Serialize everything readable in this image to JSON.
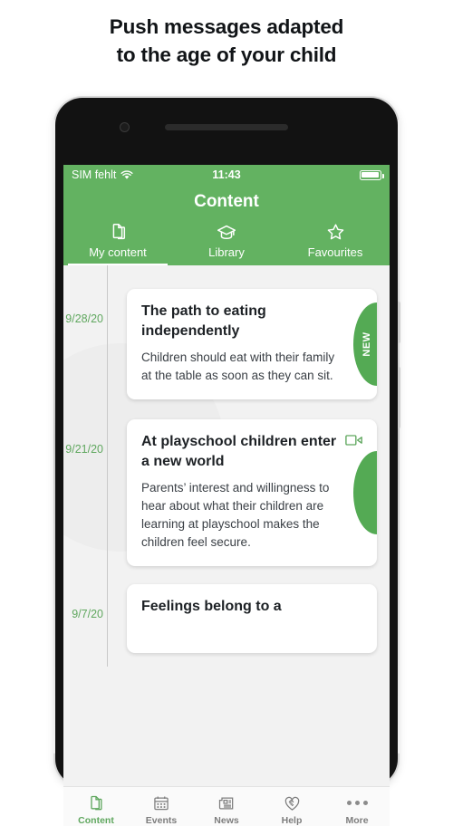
{
  "headline": {
    "line1": "Push messages adapted",
    "line2": "to the age of your child"
  },
  "status_bar": {
    "carrier": "SIM fehlt",
    "wifi_icon": "wifi-icon",
    "time": "11:43",
    "battery_icon": "battery-full-icon"
  },
  "app": {
    "title": "Content",
    "accent_color": "#63b261",
    "tabs": [
      {
        "label": "My content",
        "icon": "documents-icon",
        "active": true
      },
      {
        "label": "Library",
        "icon": "graduation-cap-icon",
        "active": false
      },
      {
        "label": "Favourites",
        "icon": "star-icon",
        "active": false
      }
    ]
  },
  "feed": {
    "items": [
      {
        "date": "9/28/20",
        "title": "The path to eating independently",
        "text": "Children should eat with their family at the table as soon as they can sit.",
        "badge": "NEW",
        "has_video": false
      },
      {
        "date": "9/21/20",
        "title": "At playschool children enter a new world",
        "text": "Parents’ interest and willingness to hear about what their children are learning at playschool makes the children feel secure.",
        "badge": "",
        "has_video": true
      },
      {
        "date": "9/7/20",
        "title": "Feelings belong to a",
        "text": "",
        "badge": "",
        "has_video": false
      }
    ]
  },
  "bottom_nav": {
    "items": [
      {
        "label": "Content",
        "icon": "documents-icon",
        "active": true
      },
      {
        "label": "Events",
        "icon": "calendar-icon",
        "active": false
      },
      {
        "label": "News",
        "icon": "newspaper-icon",
        "active": false
      },
      {
        "label": "Help",
        "icon": "handshake-heart-icon",
        "active": false
      },
      {
        "label": "More",
        "icon": "ellipsis-icon",
        "active": false
      }
    ]
  }
}
